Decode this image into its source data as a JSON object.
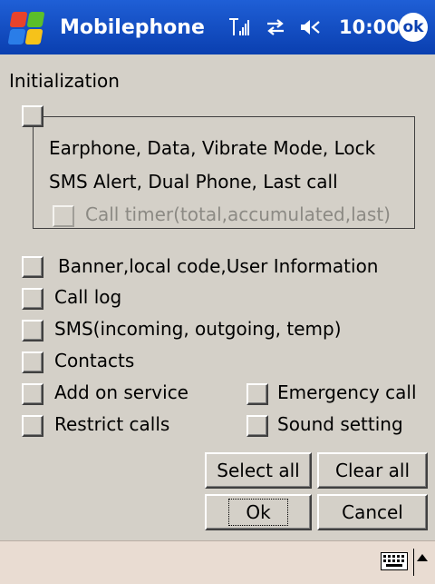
{
  "titlebar": {
    "title": "Mobilephone",
    "time": "10:00",
    "ok_label": "ok",
    "icons": [
      "windows-start-icon",
      "signal-icon",
      "connectivity-icon",
      "speaker-icon"
    ]
  },
  "section_label": "Initialization",
  "init_group": {
    "line1": "Earphone, Data, Vibrate Mode, Lock",
    "line2": "SMS Alert, Dual Phone, Last call",
    "call_timer": "Call timer(total,accumulated,last)"
  },
  "options": {
    "banner": "Banner,local code,User Information",
    "call_log": "Call log",
    "sms": "SMS(incoming, outgoing, temp)",
    "contacts": "Contacts",
    "add_on_service": "Add on service",
    "emergency_call": "Emergency call",
    "restrict_calls": "Restrict calls",
    "sound_setting": "Sound setting"
  },
  "buttons": {
    "select_all": "Select all",
    "clear_all": "Clear all",
    "ok": "Ok",
    "cancel": "Cancel"
  },
  "bottombar": {
    "icons": [
      "keyboard-icon",
      "input-menu-arrow-icon"
    ]
  }
}
